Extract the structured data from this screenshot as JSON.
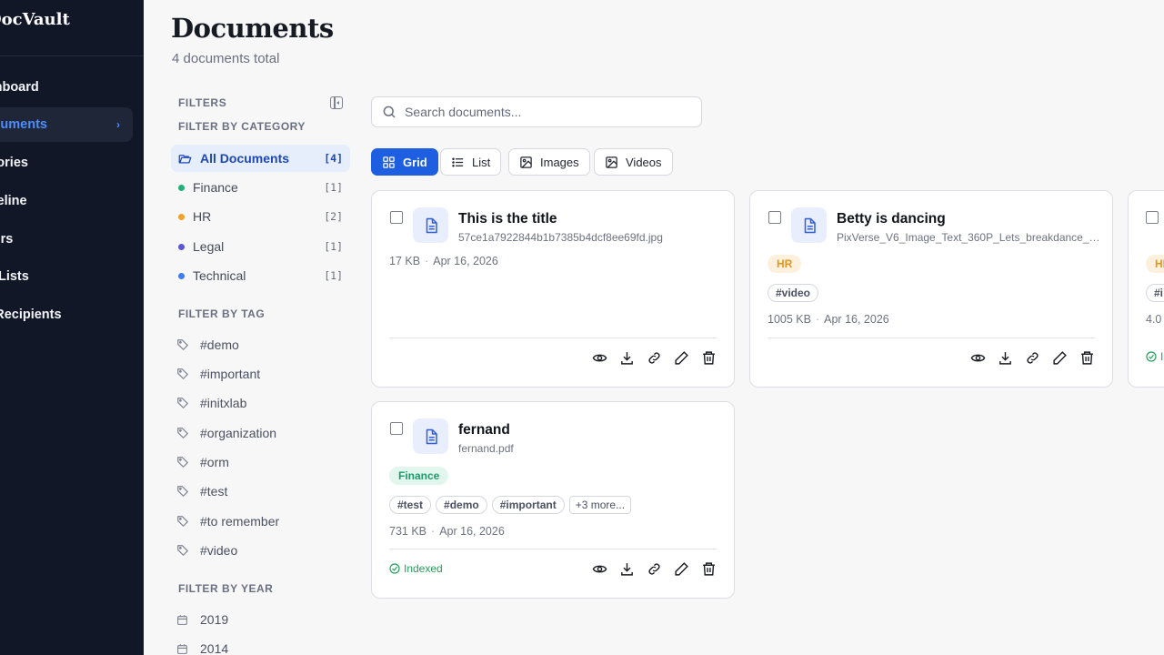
{
  "sidebar": {
    "brand": "DocVault",
    "items": [
      {
        "label": "Dashboard"
      },
      {
        "label": "Documents"
      },
      {
        "label": "Categories"
      },
      {
        "label": "Timeline"
      },
      {
        "label": "Users"
      },
      {
        "label": "Mailing Lists"
      },
      {
        "label": "Mail Recipients"
      }
    ]
  },
  "header": {
    "title": "Documents",
    "subtitle": "4 documents total"
  },
  "filters": {
    "heading": "FILTERS",
    "category_title": "FILTER BY CATEGORY",
    "categories": [
      {
        "label": "All Documents",
        "count": "[4]"
      },
      {
        "label": "Finance",
        "count": "[1]",
        "color": "#22b07d"
      },
      {
        "label": "HR",
        "count": "[2]",
        "color": "#f3a12a"
      },
      {
        "label": "Legal",
        "count": "[1]",
        "color": "#5b57d6"
      },
      {
        "label": "Technical",
        "count": "[1]",
        "color": "#3f7cf0"
      }
    ],
    "tag_title": "FILTER BY TAG",
    "tags": [
      "#demo",
      "#important",
      "#initxlab",
      "#organization",
      "#orm",
      "#test",
      "#to remember",
      "#video"
    ],
    "year_title": "FILTER BY YEAR",
    "years": [
      "2019",
      "2014"
    ]
  },
  "search": {
    "placeholder": "Search documents..."
  },
  "views": [
    "Grid",
    "List",
    "Images",
    "Videos"
  ],
  "cards": [
    {
      "title": "This is the title",
      "file": "57ce1a7922844b1b7385b4dcf8ee69fd.jpg",
      "size": "17 KB",
      "date": "Apr 16, 2026"
    },
    {
      "title": "Betty is dancing",
      "file": "PixVerse_V6_Image_Text_360P_Lets_breakdance_b...",
      "category": "HR",
      "tags": [
        "#video"
      ],
      "size": "1005 KB",
      "date": "Apr 16, 2026"
    },
    {
      "title": "fernand",
      "file": "fernand.pdf",
      "category": "Finance",
      "tags": [
        "#test",
        "#demo",
        "#important"
      ],
      "more": "+3 more...",
      "size": "731 KB",
      "date": "Apr 16, 2026",
      "status": "Indexed"
    },
    {
      "category": "HR",
      "tag_partial": "#i",
      "size_partial": "4.0",
      "status_partial": "I"
    }
  ],
  "colors": {
    "sidebar_bg": "#111726",
    "accent": "#1d5fe0",
    "active_nav": "#4d8dff"
  }
}
